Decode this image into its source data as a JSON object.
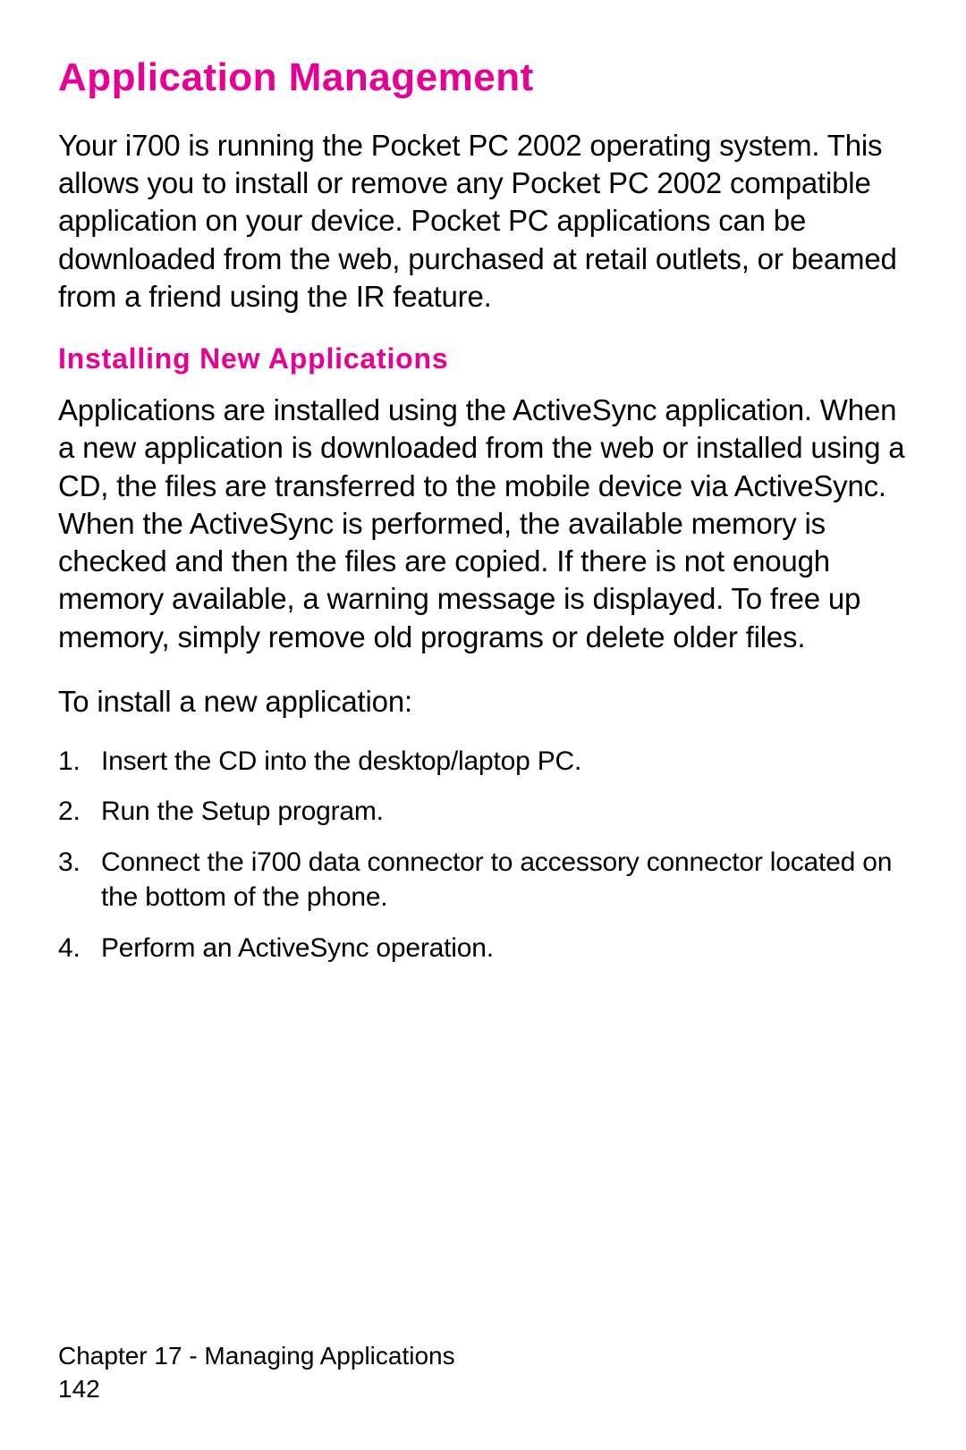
{
  "heading1": "Application Management",
  "para1": "Your i700 is running the Pocket PC 2002 operating system. This allows you to install or remove any Pocket PC 2002 compatible application on your device. Pocket PC applications can be downloaded from the web, purchased at retail outlets, or beamed from a friend using the IR feature.",
  "heading2": "Installing New Applications",
  "para2": "Applications are installed using the ActiveSync application. When a new application is downloaded from the web or installed using a CD, the files are transferred to the mobile device via ActiveSync. When the ActiveSync is performed, the available memory is checked and then the files are copied. If there is not enough memory available, a warning message is displayed. To free up memory, simply remove old programs or delete older files.",
  "leadIn": "To install a new application:",
  "steps": [
    "Insert the CD into the desktop/laptop PC.",
    "Run the Setup program.",
    "Connect the i700 data connector to accessory connector located on the bottom of the phone.",
    "Perform an ActiveSync operation."
  ],
  "footer": {
    "chapter": "Chapter 17 - Managing Applications",
    "page": "142"
  },
  "colors": {
    "accent": "#e60095"
  }
}
